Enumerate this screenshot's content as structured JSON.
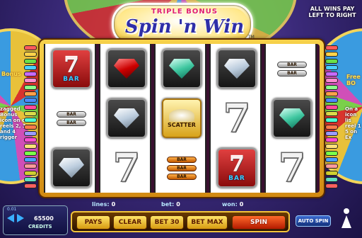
{
  "logo": {
    "top": "TRIPLE BONUS",
    "main": "Spin 'n Win",
    "tm": "TM"
  },
  "win_note": "ALL WINS PAY LEFT TO RIGHT",
  "side_left": {
    "title": "Bonus",
    "text": "zagged Bonus icon on e reels 2, 3 and 4 rigger"
  },
  "side_right": {
    "title": "Free BO",
    "text": "On a icon lis reel 1 5 on Ex"
  },
  "payline_colors": [
    "#ff5a5a",
    "#ffd24a",
    "#6ae04a",
    "#4ad0ff",
    "#c86aff",
    "#ff8ad0",
    "#8aff8a",
    "#ffa04a",
    "#4a8aff",
    "#ff4a9a",
    "#dada4a",
    "#4affd2",
    "#ff7a4a",
    "#9a9aff",
    "#ff4ad0",
    "#ffe07a",
    "#7aff4a",
    "#4aa0ff",
    "#ff9a9a",
    "#cfcf30",
    "#60e0c0",
    "#ff6060"
  ],
  "reels": [
    [
      {
        "type": "red7",
        "label": "BAR"
      },
      {
        "type": "blank"
      },
      {
        "type": "gem",
        "color": "white"
      }
    ],
    [
      {
        "type": "gem",
        "color": "red"
      },
      {
        "type": "gem",
        "color": "white"
      },
      {
        "type": "seven"
      }
    ],
    [
      {
        "type": "gem",
        "color": "green"
      },
      {
        "type": "scatter",
        "label": "SCATTER"
      },
      {
        "type": "bar",
        "count": 3,
        "style": "orange",
        "label": "BAR"
      }
    ],
    [
      {
        "type": "gem",
        "color": "white"
      },
      {
        "type": "seven"
      },
      {
        "type": "red7",
        "label": "BAR"
      }
    ],
    [
      {
        "type": "bar",
        "count": 2,
        "style": "silver",
        "label": "BAR"
      },
      {
        "type": "gem",
        "color": "green"
      },
      {
        "type": "seven"
      }
    ]
  ],
  "between_bars": [
    {
      "reel": 0,
      "after_row": 0,
      "count": 2,
      "style": "silver",
      "label": "BAR"
    }
  ],
  "stats": {
    "lines_label": "lines:",
    "lines_value": "0",
    "bet_label": "bet:",
    "bet_value": "0",
    "won_label": "won:",
    "won_value": "0"
  },
  "credits": {
    "value": "65500",
    "label": "CREDITS",
    "small": "0.01"
  },
  "buttons": {
    "pays": "PAYS",
    "clear": "CLEAR",
    "bet30": "BET 30",
    "betmax": "BET MAX",
    "spin": "SPIN",
    "autospin": "AUTO SPIN"
  }
}
